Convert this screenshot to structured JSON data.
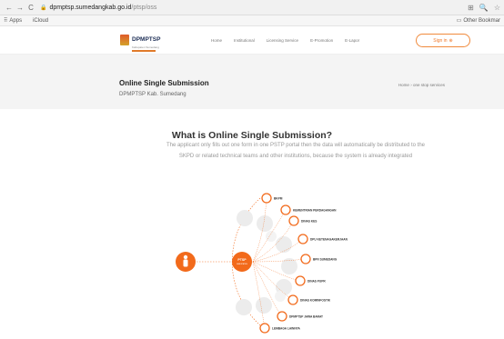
{
  "browser": {
    "url_host": "dpmptsp.sumedangkab.go.id",
    "url_path": "/ptsp/oss",
    "back": "←",
    "forward": "→",
    "reload": "C",
    "lock": "🔒",
    "translate": "⊞",
    "zoom": "🔍",
    "star": "☆"
  },
  "bookmarks": {
    "apps": "Apps",
    "icloud": "iCloud",
    "other": "Other Bookmar"
  },
  "site": {
    "logo_text": "DPMPTSP",
    "logo_sub": "Kabupaten Sumedang",
    "menu": [
      "Home",
      "Institutional",
      "Licensing Service",
      "E-Promotion",
      "E-Lapor"
    ],
    "signin": "Sign in",
    "signin_icon": "⊕"
  },
  "hero": {
    "title": "Online Single Submission",
    "subtitle": "DPMPTSP Kab. Sumedang",
    "crumb_home": "Home",
    "crumb_sep": "›",
    "crumb_current": "one stop services"
  },
  "section": {
    "title": "What is Online Single Submission?",
    "description": "The applicant only fills out one form in one PSTP portal then the data will automatically be distributed to the SKPD or related technical teams and other institutions, because the system is already integrated"
  },
  "diagram": {
    "center_label": "PTSP",
    "center_sub": "KABUPATEN",
    "nodes": [
      "BKPM",
      "KEMENTRIAN PERDAGANGAN",
      "DINAS KES",
      "DPU KETENAGAKERJAAN",
      "BPN SUMEDANG",
      "DINAS PUPR",
      "DINAS KOMINFOSTIK",
      "DPMPTSP JAWA BARAT",
      "LEMBAGA LAINNYA"
    ],
    "colors": {
      "accent": "#f26a1b",
      "muted": "#d8d8d8"
    }
  }
}
